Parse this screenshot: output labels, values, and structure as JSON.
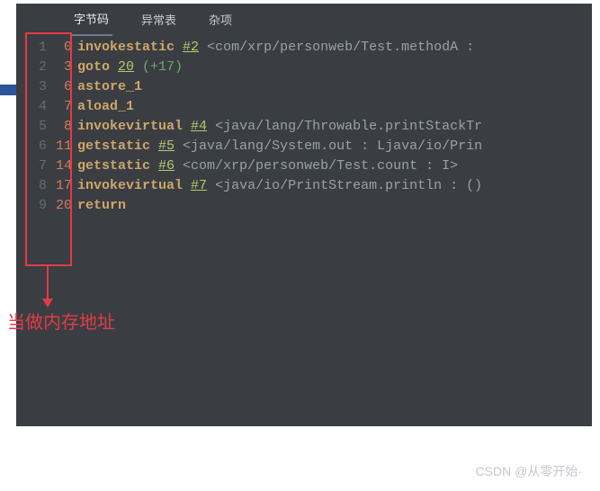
{
  "tabs": {
    "bytecode": "字节码",
    "exception_table": "异常表",
    "misc": "杂项"
  },
  "lines": [
    {
      "num": "1",
      "offset": "0",
      "op": "invokestatic",
      "ref": "#2",
      "desc": " <com/xrp/personweb/Test.methodA :"
    },
    {
      "num": "2",
      "offset": "3",
      "op": "goto",
      "jump": "20",
      "plus": " (+17)"
    },
    {
      "num": "3",
      "offset": "6",
      "op": "astore_1"
    },
    {
      "num": "4",
      "offset": "7",
      "op": "aload_1"
    },
    {
      "num": "5",
      "offset": "8",
      "op": "invokevirtual",
      "ref": "#4",
      "desc": " <java/lang/Throwable.printStackTr"
    },
    {
      "num": "6",
      "offset": "11",
      "op": "getstatic",
      "ref": "#5",
      "desc": " <java/lang/System.out : Ljava/io/Prin"
    },
    {
      "num": "7",
      "offset": "14",
      "op": "getstatic",
      "ref": "#6",
      "desc": " <com/xrp/personweb/Test.count : I>"
    },
    {
      "num": "8",
      "offset": "17",
      "op": "invokevirtual",
      "ref": "#7",
      "desc": " <java/io/PrintStream.println : ()"
    },
    {
      "num": "9",
      "offset": "20",
      "op": "return"
    }
  ],
  "annotation": "当做内存地址",
  "watermark": "CSDN @从零开始·"
}
